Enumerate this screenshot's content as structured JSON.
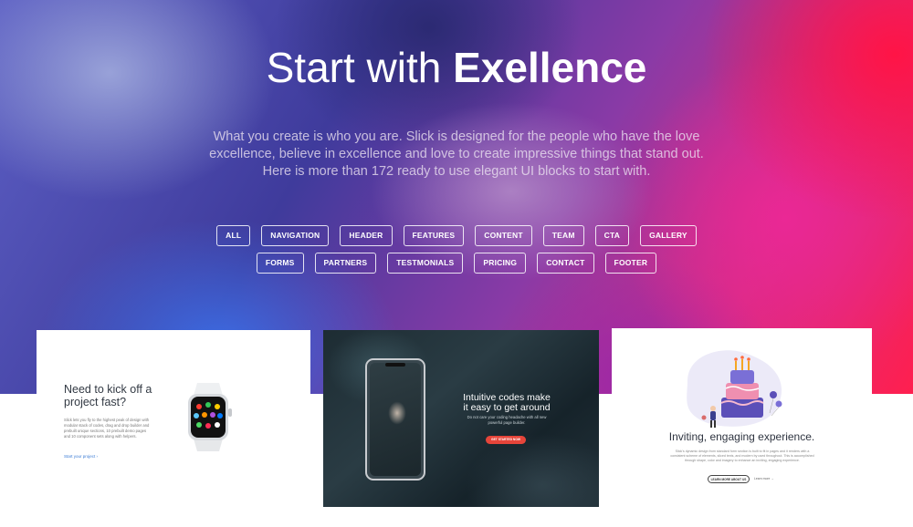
{
  "hero": {
    "title_light": "Start with ",
    "title_bold": "Exellence",
    "subtitle": "What you create is who you are. Slick is designed for the people who have the love excellence, believe in excellence and love to create impressive things that stand out. Here is more than 172 ready to use elegant UI blocks to start with."
  },
  "filters": {
    "row1": [
      "ALL",
      "NAVIGATION",
      "HEADER",
      "FEATURES",
      "CONTENT",
      "TEAM",
      "CTA",
      "GALLERY"
    ],
    "row2": [
      "FORMS",
      "PARTNERS",
      "TESTMONIALS",
      "PRICING",
      "CONTACT",
      "FOOTER"
    ]
  },
  "cards": {
    "left": {
      "title": "Need to kick off a project fast?",
      "body": "Slick lets you fly to the highest peak of design with modular stack of codes, drag and drop builder and prebuilt unique sections, 10 prebuilt demo pages and 10 component sets along with helpers.",
      "link": "Start your project  ›"
    },
    "middle": {
      "title": "Intuitive codes make it easy to get around",
      "subtitle": "Do not care your coding headache with all new powerful page builder.",
      "button": "GET STARTED NOW"
    },
    "right": {
      "title": "Inviting, engaging experience.",
      "body": "Slick's dynamic design from standard form section is built to fit in pages and it renders with a consistent scheme of elements, sliced texts, and modern by used throughout. This is accomplished through shape, color and imagery to enhance an inviting, engaging experience.",
      "button": "LEARN MORE ABOUT US",
      "link": "Learn more  →"
    }
  },
  "colors": {
    "accent_red": "#e6453a",
    "link_blue": "#3a7bd5",
    "hero_pink": "#ff1f4f",
    "hero_blue": "#3f3b9c"
  }
}
